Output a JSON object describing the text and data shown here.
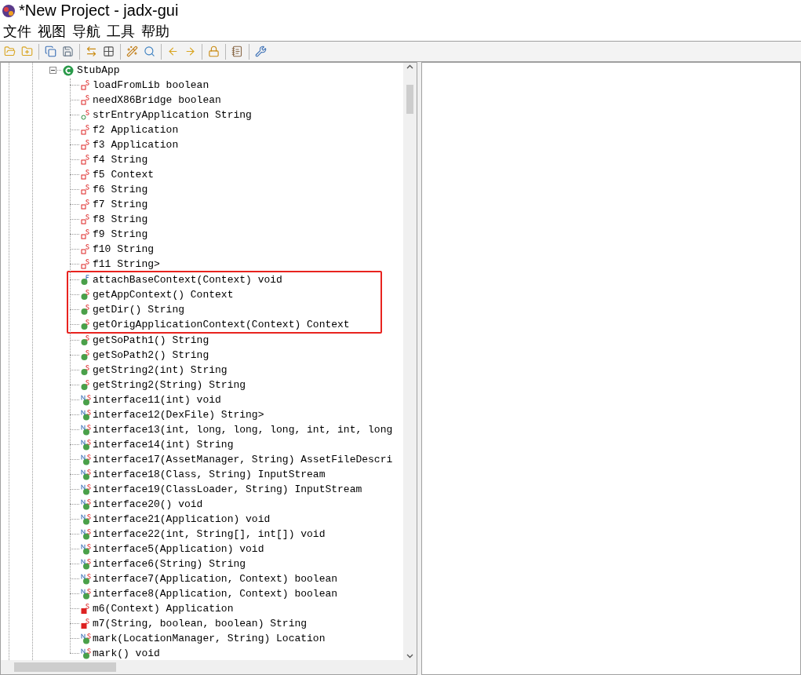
{
  "window": {
    "title": "*New Project - jadx-gui"
  },
  "menu": [
    {
      "label": "文件"
    },
    {
      "label": "视图"
    },
    {
      "label": "导航"
    },
    {
      "label": "工具"
    },
    {
      "label": "帮助"
    }
  ],
  "toolbar": [
    {
      "kind": "open"
    },
    {
      "kind": "add"
    },
    {
      "kind": "save-all",
      "separator_before": true
    },
    {
      "kind": "export"
    },
    {
      "kind": "sync",
      "separator_before": true
    },
    {
      "kind": "flatten"
    },
    {
      "kind": "wand",
      "separator_before": true
    },
    {
      "kind": "search"
    },
    {
      "kind": "back",
      "separator_before": true
    },
    {
      "kind": "forward"
    },
    {
      "kind": "lock",
      "separator_before": true
    },
    {
      "kind": "log",
      "separator_before": true
    },
    {
      "kind": "prefs",
      "separator_before": true
    }
  ],
  "tree": {
    "node": {
      "label": "StubApp",
      "expanded": true,
      "children": [
        {
          "label": "loadFromLib boolean",
          "kind": "static-field",
          "highlighted": false
        },
        {
          "label": "needX86Bridge boolean",
          "kind": "static-field",
          "highlighted": false
        },
        {
          "label": "strEntryApplication String",
          "kind": "public-static-field",
          "highlighted": false
        },
        {
          "label": "f2 Application",
          "kind": "static-field",
          "highlighted": false
        },
        {
          "label": "f3 Application",
          "kind": "static-field",
          "highlighted": false
        },
        {
          "label": "f4 String",
          "kind": "static-field",
          "highlighted": false
        },
        {
          "label": "f5 Context",
          "kind": "static-field",
          "highlighted": false
        },
        {
          "label": "f6 String",
          "kind": "static-field",
          "highlighted": false
        },
        {
          "label": "f7 String",
          "kind": "static-field",
          "highlighted": false
        },
        {
          "label": "f8 String",
          "kind": "static-field",
          "highlighted": false
        },
        {
          "label": "f9 String",
          "kind": "static-field",
          "highlighted": false
        },
        {
          "label": "f10 String",
          "kind": "static-field",
          "highlighted": false
        },
        {
          "label": "f11 String>",
          "kind": "static-field",
          "highlighted": false
        },
        {
          "label": "attachBaseContext(Context) void",
          "kind": "final-method",
          "highlighted": true
        },
        {
          "label": "getAppContext() Context",
          "kind": "static-method",
          "highlighted": true
        },
        {
          "label": "getDir() String",
          "kind": "static-method",
          "highlighted": true
        },
        {
          "label": "getOrigApplicationContext(Context) Context",
          "kind": "static-method",
          "highlighted": true
        },
        {
          "label": "getSoPath1() String",
          "kind": "static-method",
          "highlighted": false
        },
        {
          "label": "getSoPath2() String",
          "kind": "static-method",
          "highlighted": false
        },
        {
          "label": "getString2(int) String",
          "kind": "static-method",
          "highlighted": false
        },
        {
          "label": "getString2(String) String",
          "kind": "static-method",
          "highlighted": false
        },
        {
          "label": "interface11(int) void",
          "kind": "native-method",
          "highlighted": false
        },
        {
          "label": "interface12(DexFile) String>",
          "kind": "native-method",
          "highlighted": false
        },
        {
          "label": "interface13(int, long, long, long, int, int, long",
          "kind": "native-method",
          "highlighted": false
        },
        {
          "label": "interface14(int) String",
          "kind": "native-method",
          "highlighted": false
        },
        {
          "label": "interface17(AssetManager, String) AssetFileDescri",
          "kind": "native-method",
          "highlighted": false
        },
        {
          "label": "interface18(Class, String) InputStream",
          "kind": "native-method",
          "highlighted": false
        },
        {
          "label": "interface19(ClassLoader, String) InputStream",
          "kind": "native-method",
          "highlighted": false
        },
        {
          "label": "interface20() void",
          "kind": "native-method",
          "highlighted": false
        },
        {
          "label": "interface21(Application) void",
          "kind": "native-method",
          "highlighted": false
        },
        {
          "label": "interface22(int, String[], int[]) void",
          "kind": "native-method",
          "highlighted": false
        },
        {
          "label": "interface5(Application) void",
          "kind": "native-method",
          "highlighted": false
        },
        {
          "label": "interface6(String) String",
          "kind": "native-method",
          "highlighted": false
        },
        {
          "label": "interface7(Application, Context) boolean",
          "kind": "native-method",
          "highlighted": false
        },
        {
          "label": "interface8(Application, Context) boolean",
          "kind": "native-method",
          "highlighted": false
        },
        {
          "label": "m6(Context) Application",
          "kind": "private-static-method",
          "highlighted": false
        },
        {
          "label": "m7(String, boolean, boolean) String",
          "kind": "private-static-method",
          "highlighted": false
        },
        {
          "label": "mark(LocationManager, String) Location",
          "kind": "native-method",
          "highlighted": false
        },
        {
          "label": "mark() void",
          "kind": "native-method",
          "highlighted": false
        }
      ]
    }
  }
}
